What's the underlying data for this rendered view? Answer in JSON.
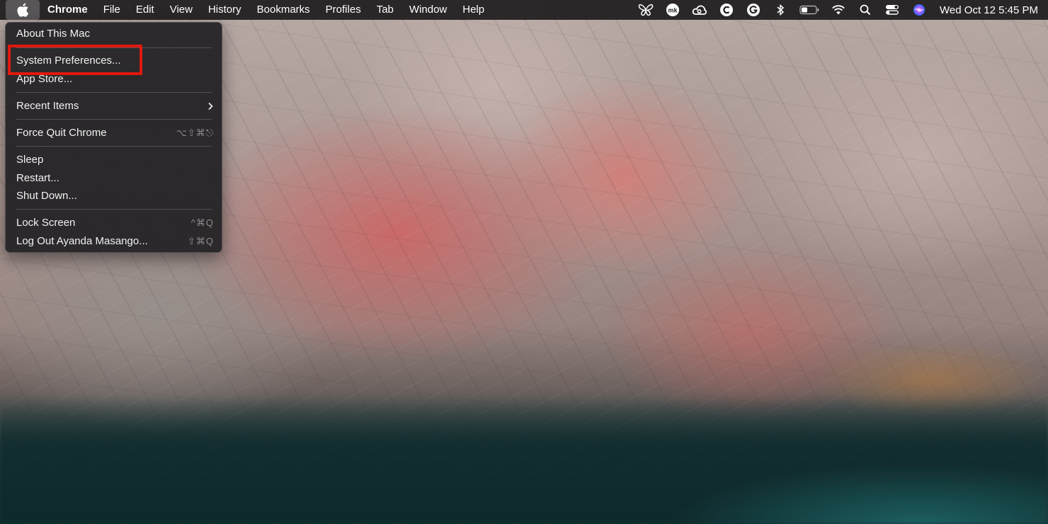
{
  "menubar": {
    "apple_icon": "apple-logo-icon",
    "app_name": "Chrome",
    "menus": [
      "File",
      "Edit",
      "View",
      "History",
      "Bookmarks",
      "Profiles",
      "Tab",
      "Window",
      "Help"
    ],
    "status_icons": [
      "butterfly-icon",
      "mk-icon",
      "creative-cloud-icon",
      "c-circle-icon",
      "grammarly-icon",
      "bluetooth-icon",
      "battery-icon",
      "wifi-icon",
      "search-icon",
      "control-center-icon",
      "siri-icon"
    ],
    "clock": "Wed Oct 12  5:45 PM"
  },
  "apple_menu": {
    "about": "About This Mac",
    "system_preferences": "System Preferences...",
    "app_store": "App Store...",
    "recent_items": "Recent Items",
    "force_quit": "Force Quit Chrome",
    "force_quit_shortcut": "⌥⇧⌘⎋",
    "sleep": "Sleep",
    "restart": "Restart...",
    "shut_down": "Shut Down...",
    "lock_screen": "Lock Screen",
    "lock_screen_shortcut": "^⌘Q",
    "log_out": "Log Out Ayanda Masango...",
    "log_out_shortcut": "⇧⌘Q"
  },
  "colors": {
    "highlight": "#e0190f",
    "menubar_bg": "#1e1c1e",
    "menu_bg": "#262428"
  }
}
